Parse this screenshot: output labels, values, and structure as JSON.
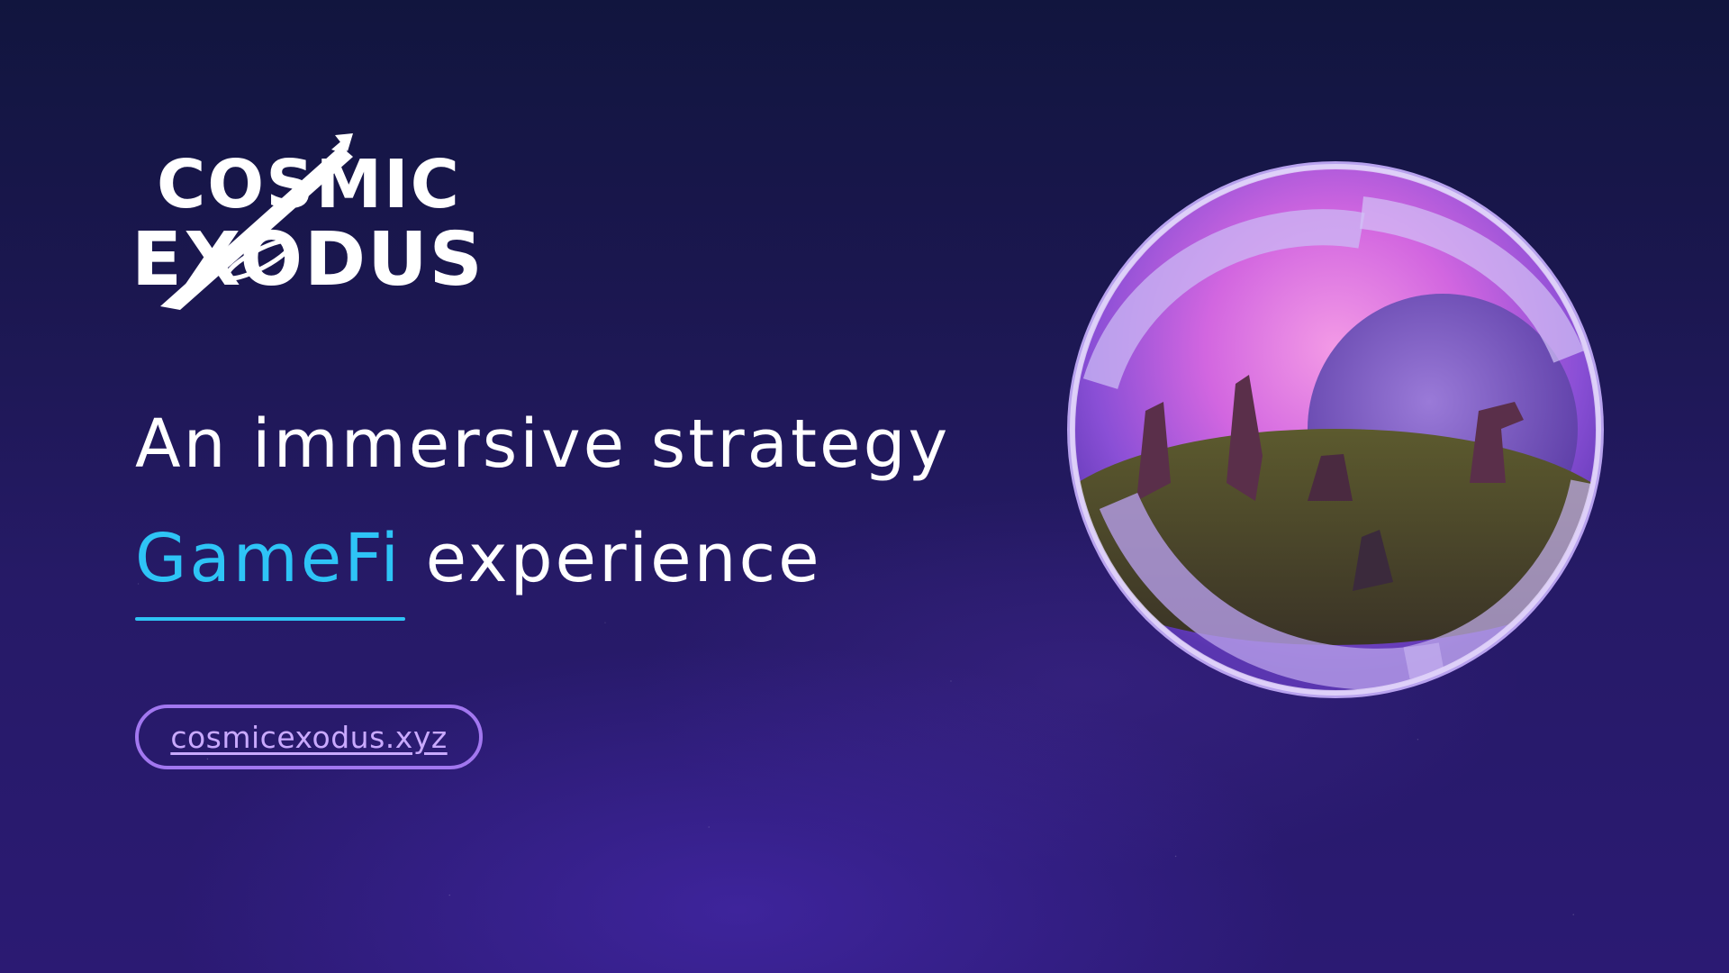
{
  "logo": {
    "line1": "COSMIC",
    "line2": "EXODUS"
  },
  "headline": {
    "line1": "An immersive strategy",
    "accent": "GameFi",
    "line2_rest": " experience"
  },
  "link": {
    "label": "cosmicexodus.xyz"
  },
  "colors": {
    "accent": "#2ec4f6",
    "pill_border": "#a277f0",
    "link_text": "#c9a9ff",
    "background": "#1b1750"
  },
  "icons": {
    "logo_mark": "rocket-trail-icon",
    "planet_in_logo": "planet-icon",
    "hero_art": "crystal-orb-landscape"
  }
}
